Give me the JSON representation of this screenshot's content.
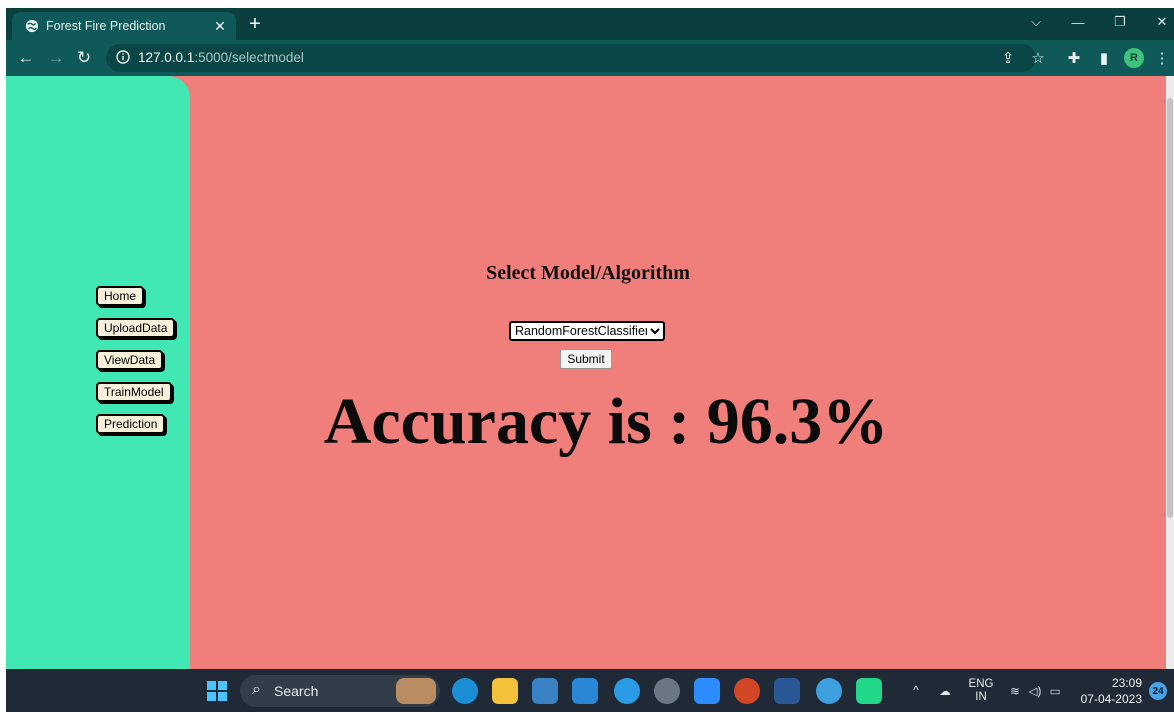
{
  "browser": {
    "tab_title": "Forest Fire Prediction",
    "tab_close": "✕",
    "new_tab": "+",
    "url_host": "127.0.0.1",
    "url_path": ":5000/selectmodel",
    "profile_initial": "R"
  },
  "page": {
    "nav": [
      "Home",
      "UploadData",
      "ViewData",
      "TrainModel",
      "Prediction"
    ],
    "heading": "Select Model/Algorithm",
    "model_select_value": "RandomForestClassifier",
    "submit_label": "Submit",
    "result_text": "Accuracy is : 96.3%"
  },
  "taskbar": {
    "search_label": "Search",
    "lang_line1": "ENG",
    "lang_line2": "IN",
    "time": "23:09",
    "date": "07-04-2023",
    "notification_count": "24"
  },
  "colors": {
    "sidebar": "#42e8b3",
    "content_bg": "#f07f7c",
    "browser_chrome": "#0f5958"
  }
}
